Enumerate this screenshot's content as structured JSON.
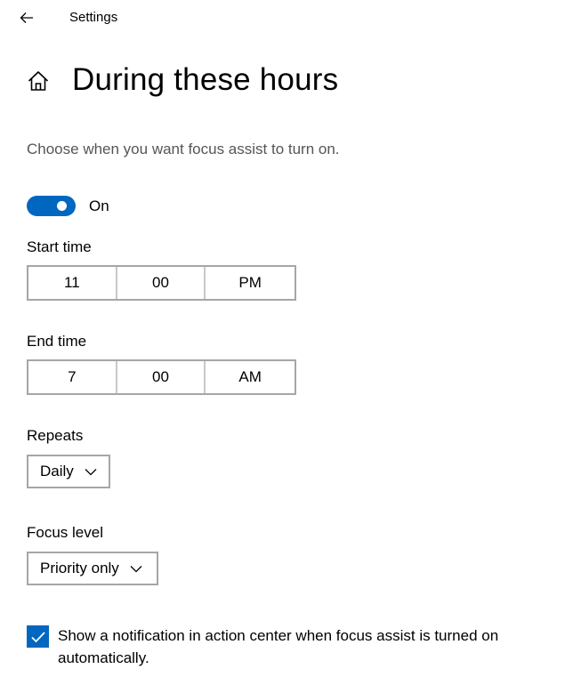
{
  "header": {
    "back_label": "Back",
    "title": "Settings"
  },
  "page": {
    "title": "During these hours",
    "description": "Choose when you want focus assist to turn on."
  },
  "toggle": {
    "state_label": "On",
    "on": true
  },
  "start_time": {
    "label": "Start time",
    "hour": "11",
    "minute": "00",
    "period": "PM"
  },
  "end_time": {
    "label": "End time",
    "hour": "7",
    "minute": "00",
    "period": "AM"
  },
  "repeats": {
    "label": "Repeats",
    "value": "Daily"
  },
  "focus_level": {
    "label": "Focus level",
    "value": "Priority only"
  },
  "notification": {
    "checked": true,
    "label": "Show a notification in action center when focus assist is turned on automatically."
  },
  "colors": {
    "accent": "#0067c0",
    "border": "#a6a6a6",
    "description_text": "#555555"
  },
  "icons": {
    "back": "arrow-left-icon",
    "home": "home-icon",
    "chevron": "chevron-down-icon",
    "check": "checkmark-icon"
  }
}
